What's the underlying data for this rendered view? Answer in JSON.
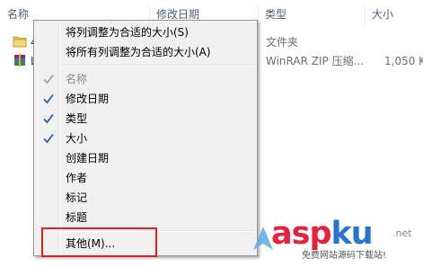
{
  "columns": {
    "name": "名称",
    "modified": "修改日期",
    "type": "类型",
    "size": "大小"
  },
  "rows": [
    {
      "name_fragment": "4",
      "type": "文件夹",
      "size": ""
    },
    {
      "name_fragment": "L",
      "type": "WinRAR ZIP 压缩...",
      "size": "1,050 K"
    }
  ],
  "menu": {
    "fit_column": "将列调整为合适的大小(S)",
    "fit_all_columns": "将所有列调整为合适的大小(A)",
    "columns": [
      {
        "label": "名称",
        "checked": true,
        "disabled": true
      },
      {
        "label": "修改日期",
        "checked": true,
        "disabled": false
      },
      {
        "label": "类型",
        "checked": true,
        "disabled": false
      },
      {
        "label": "大小",
        "checked": true,
        "disabled": false
      },
      {
        "label": "创建日期",
        "checked": false,
        "disabled": false
      },
      {
        "label": "作者",
        "checked": false,
        "disabled": false
      },
      {
        "label": "标记",
        "checked": false,
        "disabled": false
      },
      {
        "label": "标题",
        "checked": false,
        "disabled": false
      }
    ],
    "more": "其他(M)..."
  },
  "watermark": {
    "brand_main": "asp",
    "brand_accent": "ku",
    "domain_suffix": ".net",
    "tagline": "免费网站源码下载站!"
  },
  "colors": {
    "highlight": "#e02020",
    "check": "#2f5dad",
    "watermark_red": "#e2233b",
    "watermark_blue": "#2a73c9"
  }
}
